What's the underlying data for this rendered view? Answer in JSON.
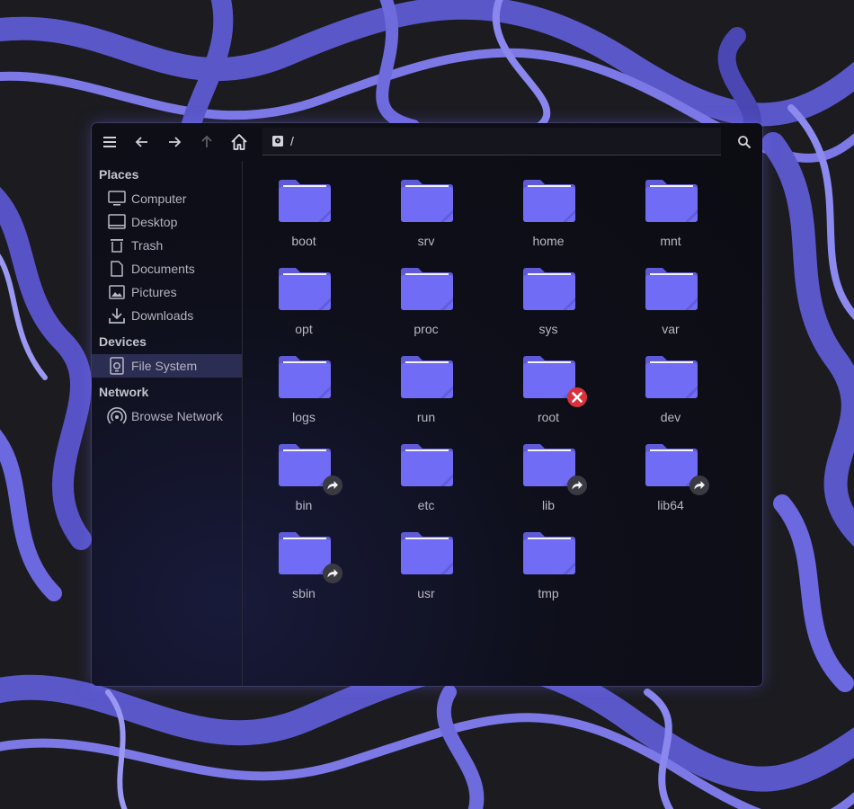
{
  "colors": {
    "accent": "#6c68f0",
    "folder_back": "#5f5bd8",
    "folder_front": "#716cf6",
    "sidebar_active": "#2c2d52",
    "error_emblem": "#d8323c"
  },
  "header": {
    "path": "/",
    "buttons": [
      "menu-icon",
      "back-arrow-icon",
      "forward-arrow-icon",
      "up-arrow-icon",
      "home-icon",
      "search-icon"
    ]
  },
  "sidebar": {
    "sections": [
      {
        "title": "Places",
        "items": [
          {
            "label": "Computer",
            "icon": "computer-icon"
          },
          {
            "label": "Desktop",
            "icon": "desktop-icon"
          },
          {
            "label": "Trash",
            "icon": "trash-icon"
          },
          {
            "label": "Documents",
            "icon": "document-icon"
          },
          {
            "label": "Pictures",
            "icon": "pictures-icon"
          },
          {
            "label": "Downloads",
            "icon": "download-icon"
          }
        ]
      },
      {
        "title": "Devices",
        "items": [
          {
            "label": "File System",
            "icon": "drive-icon",
            "active": true
          }
        ]
      },
      {
        "title": "Network",
        "items": [
          {
            "label": "Browse Network",
            "icon": "network-icon"
          }
        ]
      }
    ]
  },
  "folders": [
    {
      "name": "boot"
    },
    {
      "name": "srv"
    },
    {
      "name": "home"
    },
    {
      "name": "mnt"
    },
    {
      "name": "opt"
    },
    {
      "name": "proc"
    },
    {
      "name": "sys"
    },
    {
      "name": "var"
    },
    {
      "name": "logs"
    },
    {
      "name": "run"
    },
    {
      "name": "root",
      "emblem": "unreadable"
    },
    {
      "name": "dev"
    },
    {
      "name": "bin",
      "emblem": "symlink"
    },
    {
      "name": "etc"
    },
    {
      "name": "lib",
      "emblem": "symlink"
    },
    {
      "name": "lib64",
      "emblem": "symlink"
    },
    {
      "name": "sbin",
      "emblem": "symlink"
    },
    {
      "name": "usr"
    },
    {
      "name": "tmp"
    }
  ]
}
